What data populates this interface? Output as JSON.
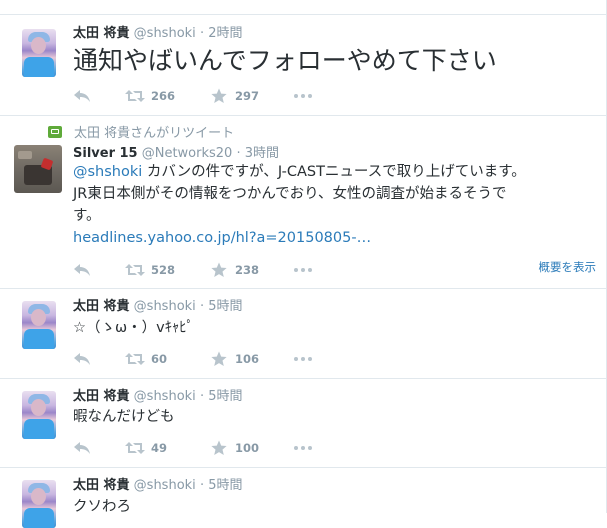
{
  "tweets": [
    {
      "name": "太田 将貴",
      "handle": "@shshoki",
      "dot": "·",
      "time": "2時間",
      "text": "通知やばいんでフォローやめて下さい",
      "retweets": "266",
      "favorites": "297"
    },
    {
      "retweet_context": "太田 将貴さんがリツイート",
      "name": "Silver 15",
      "handle": "@Networks20",
      "dot": "·",
      "time": "3時間",
      "mention": "@shshoki",
      "text_after_mention": " カバンの件ですが、J-CASTニュースで取り上げています。",
      "text_line2": "JR東日本側がその情報をつかんでおり、女性の調査が始まるそうで",
      "text_line3": "す。",
      "link": "headlines.yahoo.co.jp/hl?a=20150805-…",
      "retweets": "528",
      "favorites": "238",
      "summary": "概要を表示"
    },
    {
      "name": "太田 将貴",
      "handle": "@shshoki",
      "dot": "·",
      "time": "5時間",
      "text": "☆（ゝω・）vｷｬﾋﾟ",
      "retweets": "60",
      "favorites": "106"
    },
    {
      "name": "太田 将貴",
      "handle": "@shshoki",
      "dot": "·",
      "time": "5時間",
      "text": "暇なんだけども",
      "retweets": "49",
      "favorites": "100"
    },
    {
      "name": "太田 将貴",
      "handle": "@shshoki",
      "dot": "·",
      "time": "5時間",
      "text": "クソわろ"
    }
  ],
  "colors": {
    "text": "#292f33",
    "muted": "#8899a6",
    "link": "#2b7bb9",
    "border": "#e1e8ed",
    "retweet_badge": "#5faa3a"
  },
  "icons": [
    "reply-icon",
    "retweet-icon",
    "favorite-icon",
    "more-icon",
    "retweet-badge-icon"
  ]
}
